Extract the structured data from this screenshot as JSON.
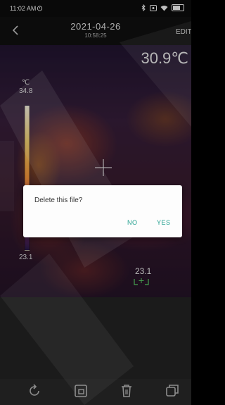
{
  "status_bar": {
    "time": "11:02 AM",
    "icons": [
      "alarm-icon",
      "bluetooth-icon",
      "nfc-icon",
      "wifi-icon",
      "battery-icon"
    ]
  },
  "header": {
    "date": "2021-04-26",
    "time": "10:58:25",
    "edit_label": "EDIT"
  },
  "thermal": {
    "current_temp": "30.9℃",
    "unit": "℃",
    "scale_max": "34.8",
    "scale_min": "23.1",
    "spot_value": "23.1"
  },
  "dialog": {
    "message": "Delete this file?",
    "no_label": "NO",
    "yes_label": "YES",
    "accent_color": "#1f9e8d"
  },
  "toolbar": {
    "icons": [
      "rotate-icon",
      "gallery-icon",
      "delete-icon",
      "copy-icon"
    ]
  }
}
